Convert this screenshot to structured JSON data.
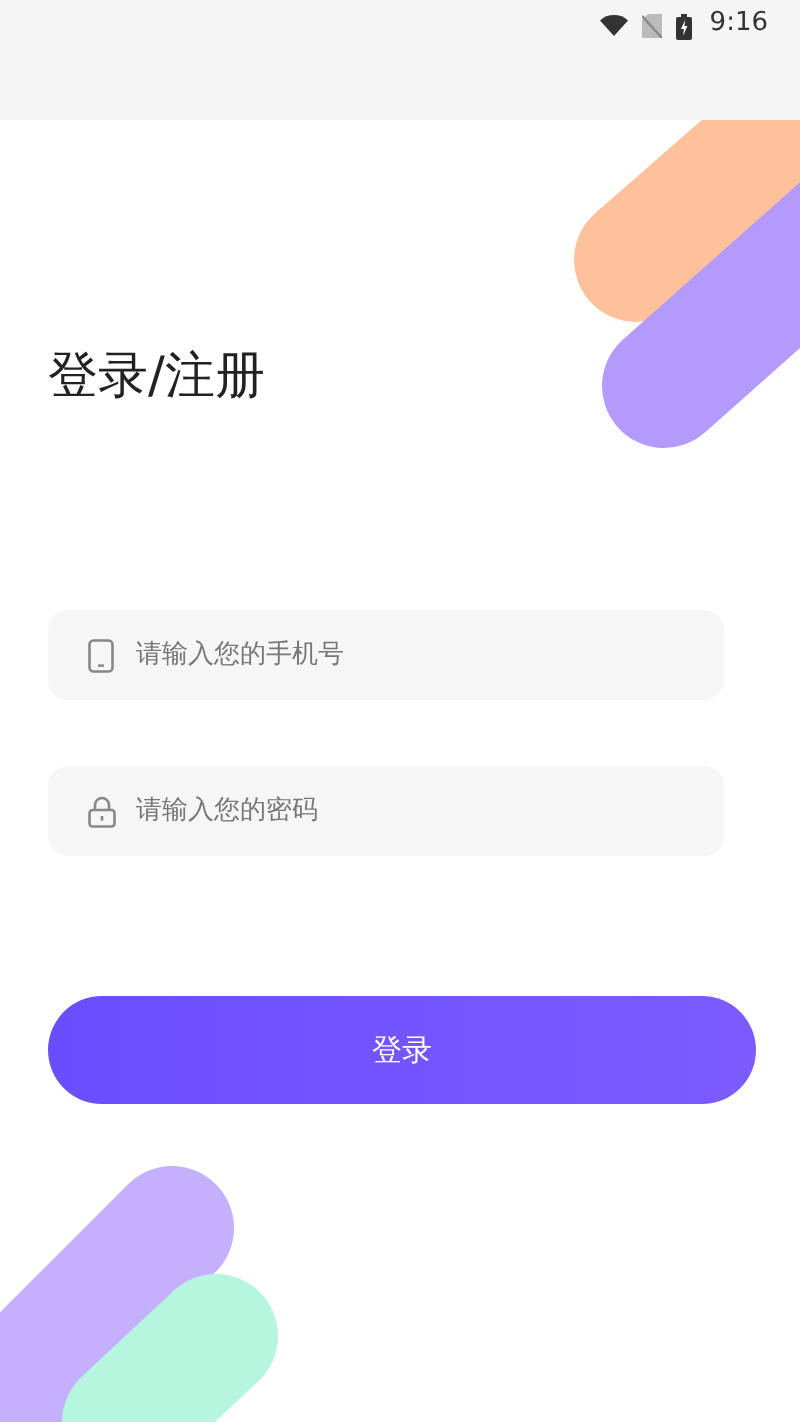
{
  "status_bar": {
    "time": "9:16"
  },
  "title": "登录/注册",
  "fields": [
    {
      "kind": "phone",
      "placeholder": "请输入您的手机号"
    },
    {
      "kind": "password",
      "placeholder": "请输入您的密码"
    }
  ],
  "button": {
    "label": "登录"
  }
}
